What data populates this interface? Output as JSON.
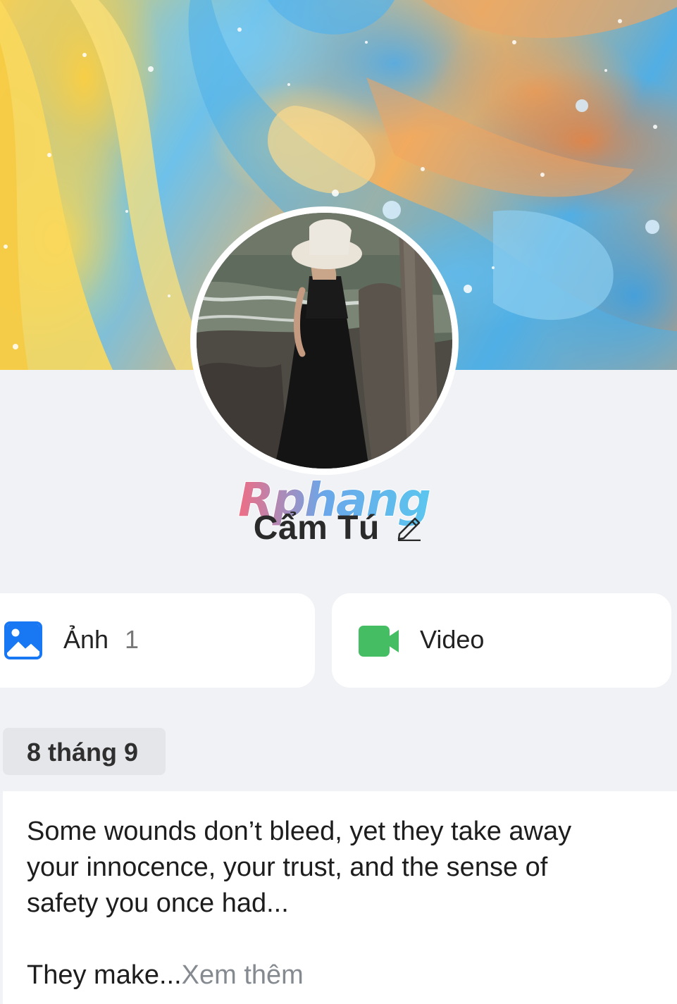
{
  "profile": {
    "name": "Cẩm Tú",
    "watermark_text": "Rphang"
  },
  "media": {
    "photos_label": "Ảnh",
    "photos_count": "1",
    "videos_label": "Video"
  },
  "post": {
    "date": "8 tháng 9",
    "text_lines": [
      "Some wounds don’t bleed, yet they take away",
      "your innocence, your trust, and the sense of",
      "safety you once had..."
    ],
    "teaser": "They make...",
    "see_more": "Xem thêm"
  },
  "colors": {
    "background": "#f1f2f6",
    "photo_icon": "#1877f2",
    "video_icon": "#45bd62",
    "see_more": "#858a90"
  },
  "icons": [
    "edit-pencil-icon",
    "photo-icon",
    "video-camera-icon"
  ]
}
